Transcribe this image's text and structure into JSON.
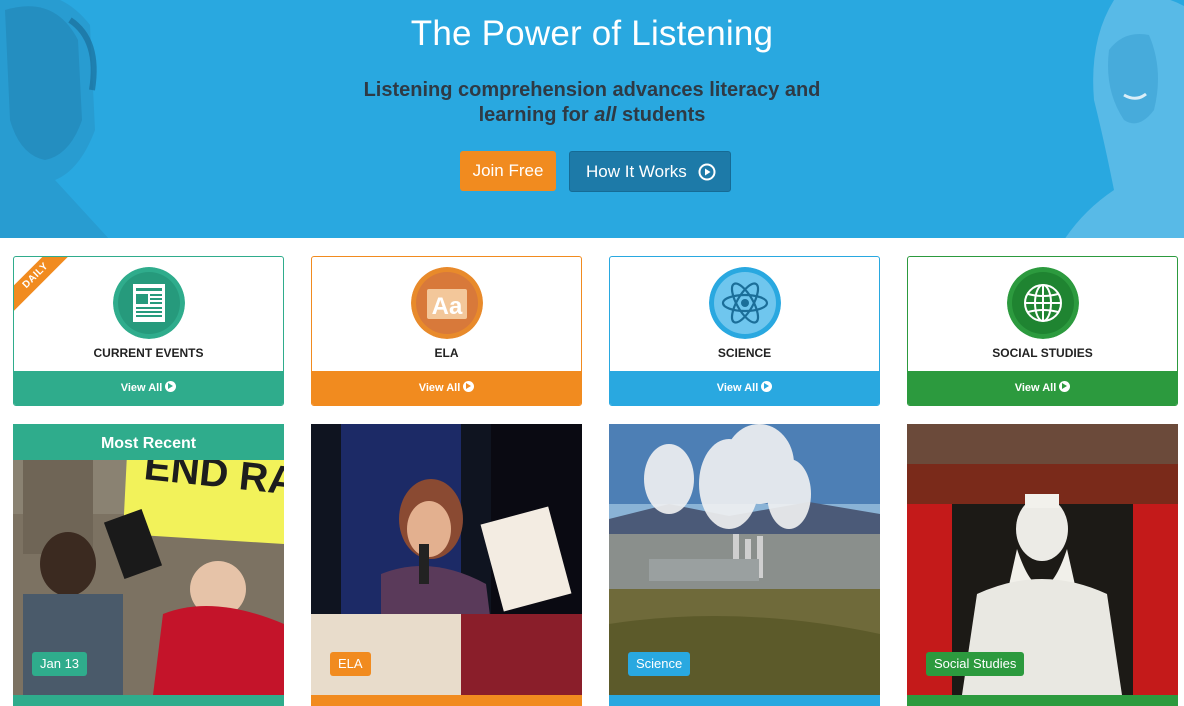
{
  "hero": {
    "title": "The Power of Listening",
    "subtitle_line1": "Listening comprehension advances literacy and",
    "subtitle_pre": "learning for ",
    "subtitle_em": "all",
    "subtitle_post": " students",
    "join_label": "Join Free",
    "how_label": "How It Works"
  },
  "categories": [
    {
      "label": "CURRENT EVENTS",
      "view_all": "View All",
      "ribbon": "DAILY",
      "color": "#2fac8c",
      "icon": "newspaper-icon"
    },
    {
      "label": "ELA",
      "view_all": "View All",
      "color": "#f18b1f",
      "icon": "letters-aa-icon"
    },
    {
      "label": "SCIENCE",
      "view_all": "View All",
      "color": "#29a8e0",
      "icon": "atom-icon"
    },
    {
      "label": "SOCIAL STUDIES",
      "view_all": "View All",
      "color": "#2c9a3e",
      "icon": "globe-icon"
    }
  ],
  "tiles": [
    {
      "header": "Most Recent",
      "badge": "Jan 13",
      "color": "#2fac8c",
      "image": "protest-end-racism-photo"
    },
    {
      "badge": "ELA",
      "color": "#f18b1f",
      "image": "author-reading-at-podium-photo"
    },
    {
      "badge": "Science",
      "color": "#29a8e0",
      "image": "geothermal-plant-photo"
    },
    {
      "badge": "Social Studies",
      "color": "#2c9a3e",
      "image": "confucius-statue-photo"
    }
  ],
  "decor": {
    "protest_sign": "END RACISM",
    "ela_icon_text": "Aa"
  }
}
